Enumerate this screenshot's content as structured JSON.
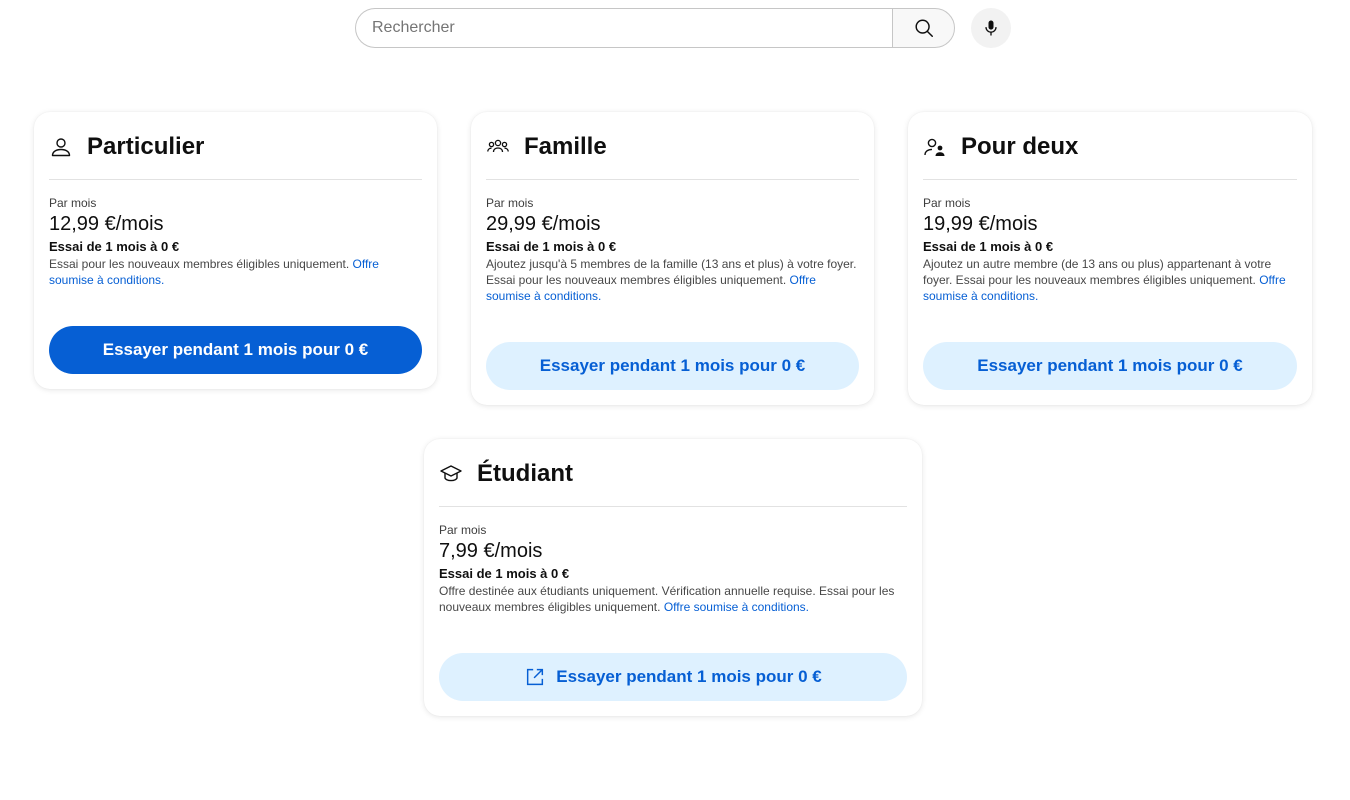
{
  "search": {
    "placeholder": "Rechercher",
    "search_icon": "search-icon",
    "mic_icon": "mic-icon"
  },
  "plans": [
    {
      "icon": "person-icon",
      "title": "Particulier",
      "per_month_label": "Par mois",
      "price": "12,99 €/mois",
      "trial": "Essai de 1 mois à 0 €",
      "description": "Essai pour les nouveaux membres éligibles uniquement.",
      "link": "Offre soumise à conditions.",
      "cta": "Essayer pendant 1 mois pour 0 €"
    },
    {
      "icon": "family-icon",
      "title": "Famille",
      "per_month_label": "Par mois",
      "price": "29,99 €/mois",
      "trial": "Essai de 1 mois à 0 €",
      "description": "Ajoutez jusqu'à 5 membres de la famille (13 ans et plus) à votre foyer. Essai pour les nouveaux membres éligibles uniquement.",
      "link": "Offre soumise à conditions.",
      "cta": "Essayer pendant 1 mois pour 0 €"
    },
    {
      "icon": "two-people-icon",
      "title": "Pour deux",
      "per_month_label": "Par mois",
      "price": "19,99 €/mois",
      "trial": "Essai de 1 mois à 0 €",
      "description": "Ajoutez un autre membre (de 13 ans ou plus) appartenant à votre foyer. Essai pour les nouveaux membres éligibles uniquement.",
      "link": "Offre soumise à conditions.",
      "cta": "Essayer pendant 1 mois pour 0 €"
    },
    {
      "icon": "graduation-cap-icon",
      "title": "Étudiant",
      "per_month_label": "Par mois",
      "price": "7,99 €/mois",
      "trial": "Essai de 1 mois à 0 €",
      "description": "Offre destinée aux étudiants uniquement. Vérification annuelle requise. Essai pour les nouveaux membres éligibles uniquement.",
      "link": "Offre soumise à conditions.",
      "cta_icon": "external-link-icon",
      "cta": "Essayer pendant 1 mois pour 0 €"
    }
  ],
  "colors": {
    "primary": "#065fd4",
    "secondary_bg": "#def1ff",
    "text": "#0f0f0f"
  }
}
